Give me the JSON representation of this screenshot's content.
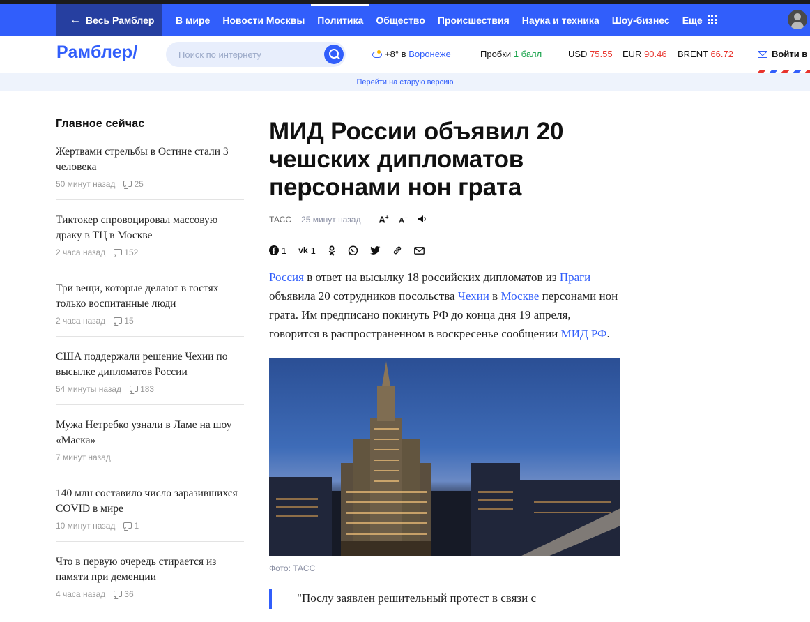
{
  "nav": {
    "back_label": "Весь Рамблер",
    "items": [
      {
        "label": "В мире"
      },
      {
        "label": "Новости Москвы"
      },
      {
        "label": "Политика"
      },
      {
        "label": "Общество"
      },
      {
        "label": "Происшествия"
      },
      {
        "label": "Наука и техника"
      },
      {
        "label": "Шоу-бизнес"
      },
      {
        "label": "Еще"
      }
    ],
    "active_index": 2
  },
  "header": {
    "logo": "Рамблер/",
    "search_placeholder": "Поиск по интернету",
    "weather": {
      "temp": "+8°",
      "in": "в",
      "city": "Воронеже"
    },
    "traffic": {
      "label": "Пробки",
      "value": "1 балл"
    },
    "currencies": [
      {
        "code": "USD",
        "value": "75.55"
      },
      {
        "code": "EUR",
        "value": "90.46"
      },
      {
        "code": "BRENT",
        "value": "66.72"
      }
    ],
    "login": "Войти в п"
  },
  "old_version_link": "Перейти на старую версию",
  "sidebar": {
    "title": "Главное сейчас",
    "items": [
      {
        "headline": "Жертвами стрельбы в Остине стали 3 человека",
        "time": "50 минут назад",
        "comments": "25"
      },
      {
        "headline": "Тиктокер спровоцировал массовую драку в ТЦ в Москве",
        "time": "2 часа назад",
        "comments": "152"
      },
      {
        "headline": "Три вещи, которые делают в гостях только воспитанные люди",
        "time": "2 часа назад",
        "comments": "15"
      },
      {
        "headline": "США поддержали решение Чехии по высылке дипломатов России",
        "time": "54 минуты назад",
        "comments": "183"
      },
      {
        "headline": "Мужа Нетребко узнали в Ламе на шоу «Маска»",
        "time": "7 минут назад",
        "comments": ""
      },
      {
        "headline": "140 млн составило число заразившихся COVID в мире",
        "time": "10 минут назад",
        "comments": "1"
      },
      {
        "headline": "Что в первую очередь стирается из памяти при деменции",
        "time": "4 часа назад",
        "comments": "36"
      }
    ]
  },
  "article": {
    "title": "МИД России объявил 20 чешских дипломатов персонами нон грата",
    "source": "ТАСС",
    "time": "25 минут назад",
    "controls": {
      "font_up": "A",
      "font_down": "A"
    },
    "share": {
      "facebook_count": "1",
      "vk_count": "1"
    },
    "body": {
      "link_russia": "Россия",
      "t1": " в ответ на высылку 18 российских дипломатов из ",
      "link_prague": "Праги",
      "t2": " объявила 20 сотрудников посольства ",
      "link_czech": "Чехии",
      "t3": " в ",
      "link_moscow": "Москве",
      "t4": " персонами нон грата. Им предписано покинуть РФ до конца дня 19 апреля, говорится в распространенном в воскресенье сообщении ",
      "link_mid": "МИД РФ",
      "t5": "."
    },
    "photo_caption": "Фото: ТАСС",
    "quote_start": "\"Послу заявлен решительный протест в связи с"
  },
  "colors": {
    "brand": "#315efb",
    "back_button": "#263fa0",
    "positive": "#17a34a",
    "negative": "#e8332c"
  }
}
